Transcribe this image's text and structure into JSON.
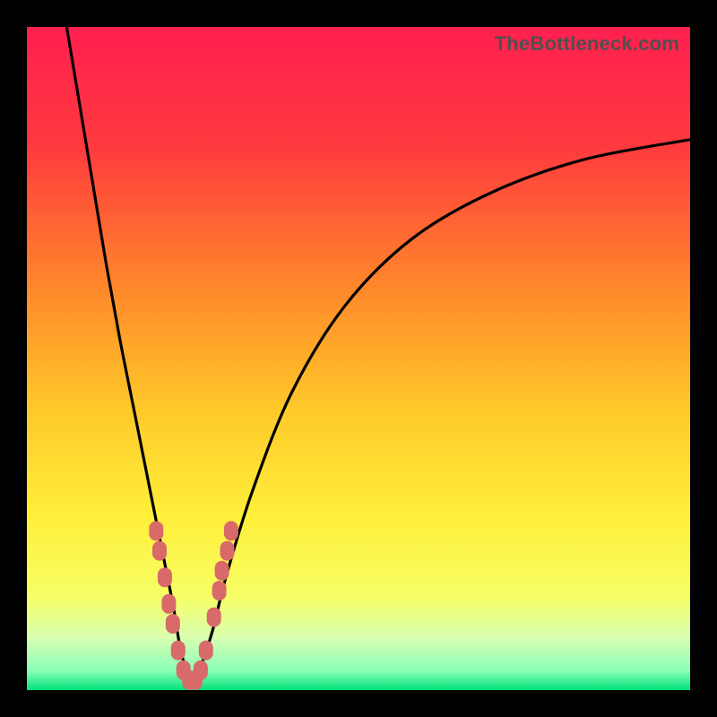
{
  "watermark": "TheBottleneck.com",
  "colors": {
    "gradient_stops": [
      {
        "offset": 0.0,
        "color": "#ff1f4f"
      },
      {
        "offset": 0.18,
        "color": "#ff3a3e"
      },
      {
        "offset": 0.4,
        "color": "#ff8a2a"
      },
      {
        "offset": 0.58,
        "color": "#ffca2a"
      },
      {
        "offset": 0.74,
        "color": "#ffef3a"
      },
      {
        "offset": 0.86,
        "color": "#f6ff66"
      },
      {
        "offset": 0.92,
        "color": "#d9ffb0"
      },
      {
        "offset": 0.97,
        "color": "#8cffb8"
      },
      {
        "offset": 1.0,
        "color": "#00e27a"
      }
    ],
    "marker": "#d86a6a",
    "curve": "#000000",
    "frame": "#000000"
  },
  "chart_data": {
    "type": "line",
    "title": "",
    "xlabel": "",
    "ylabel": "",
    "xlim": [
      0,
      100
    ],
    "ylim": [
      0,
      100
    ],
    "grid": false,
    "legend": false,
    "series": [
      {
        "name": "bottleneck-curve",
        "x": [
          6,
          8,
          10,
          12,
          14,
          16,
          18,
          20,
          22,
          23,
          24,
          25,
          26,
          28,
          30,
          34,
          40,
          48,
          58,
          70,
          84,
          100
        ],
        "y": [
          100,
          88,
          76,
          64,
          53,
          43,
          33,
          23,
          13,
          7,
          3,
          1,
          3,
          9,
          17,
          30,
          45,
          58,
          68,
          75,
          80,
          83
        ]
      }
    ],
    "markers": [
      {
        "x": 19.5,
        "y": 24
      },
      {
        "x": 20.0,
        "y": 21
      },
      {
        "x": 20.8,
        "y": 17
      },
      {
        "x": 21.4,
        "y": 13
      },
      {
        "x": 22.0,
        "y": 10
      },
      {
        "x": 22.8,
        "y": 6
      },
      {
        "x": 23.6,
        "y": 3
      },
      {
        "x": 24.5,
        "y": 1.5
      },
      {
        "x": 25.4,
        "y": 1.5
      },
      {
        "x": 26.2,
        "y": 3
      },
      {
        "x": 27.0,
        "y": 6
      },
      {
        "x": 28.2,
        "y": 11
      },
      {
        "x": 29.0,
        "y": 15
      },
      {
        "x": 29.4,
        "y": 18
      },
      {
        "x": 30.2,
        "y": 21
      },
      {
        "x": 30.8,
        "y": 24
      }
    ],
    "minimum_at_x": 25
  }
}
